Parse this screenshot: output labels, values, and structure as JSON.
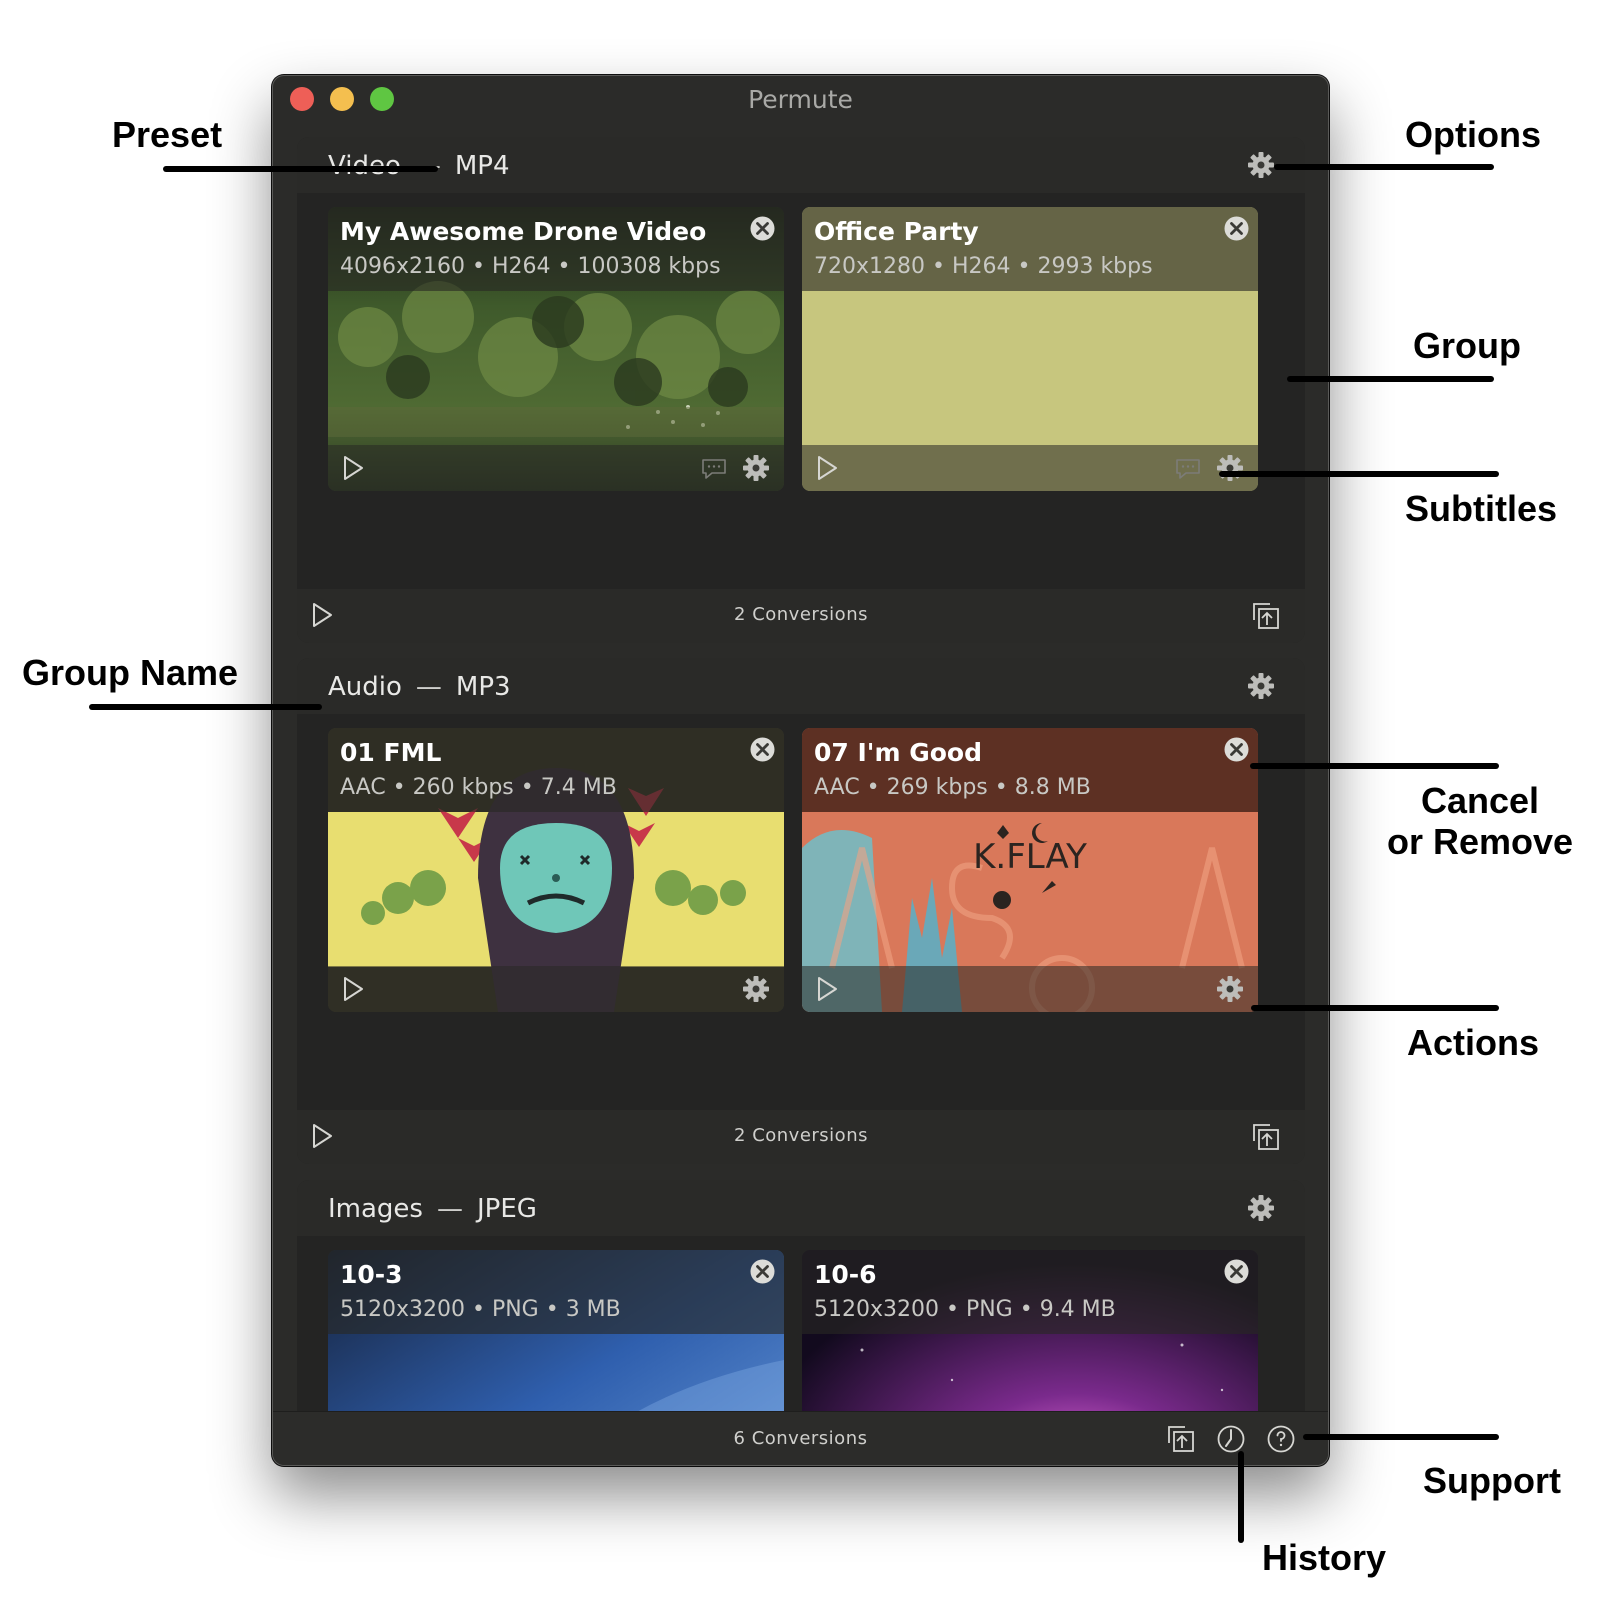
{
  "window": {
    "title": "Permute"
  },
  "groups": [
    {
      "name": "Video",
      "separator": "—",
      "preset": "MP4",
      "footer_count": "2 Conversions",
      "items": [
        {
          "title": "My Awesome Drone Video",
          "meta": "4096x2160 • H264 • 100308 kbps",
          "thumbnail": "foliage"
        },
        {
          "title": "Office Party",
          "meta": "720x1280 • H264 • 2993 kbps",
          "thumbnail": "yellow"
        }
      ]
    },
    {
      "name": "Audio",
      "separator": "—",
      "preset": "MP3",
      "footer_count": "2 Conversions",
      "items": [
        {
          "title": "01 FML",
          "meta": "AAC • 260 kbps • 7.4 MB",
          "thumbnail": "cartoon-cover"
        },
        {
          "title": "07 I'm Good",
          "meta": "AAC • 269 kbps • 8.8 MB",
          "thumbnail": "k-flay-cover",
          "cover_text": "K.FLAY"
        }
      ]
    },
    {
      "name": "Images",
      "separator": "—",
      "preset": "JPEG",
      "items": [
        {
          "title": "10-3",
          "meta": "5120x3200 • PNG • 3 MB",
          "thumbnail": "blue-wallpaper"
        },
        {
          "title": "10-6",
          "meta": "5120x3200 • PNG • 9.4 MB",
          "thumbnail": "galaxy-wallpaper"
        }
      ]
    }
  ],
  "bottom_bar": {
    "count": "6 Conversions",
    "icons": [
      "export-icon",
      "history-icon",
      "support-icon"
    ]
  },
  "annotations": {
    "preset": "Preset",
    "options": "Options",
    "group": "Group",
    "subtitles": "Subtitles",
    "group_name": "Group Name",
    "cancel_line1": "Cancel",
    "cancel_line2": "or Remove",
    "actions": "Actions",
    "support": "Support",
    "history": "History"
  },
  "colors": {
    "window_bg": "#2b2b29",
    "group_bg": "#242423",
    "traffic_red": "#ee5f57",
    "traffic_yellow": "#f4bf4f",
    "traffic_green": "#5fc642"
  }
}
